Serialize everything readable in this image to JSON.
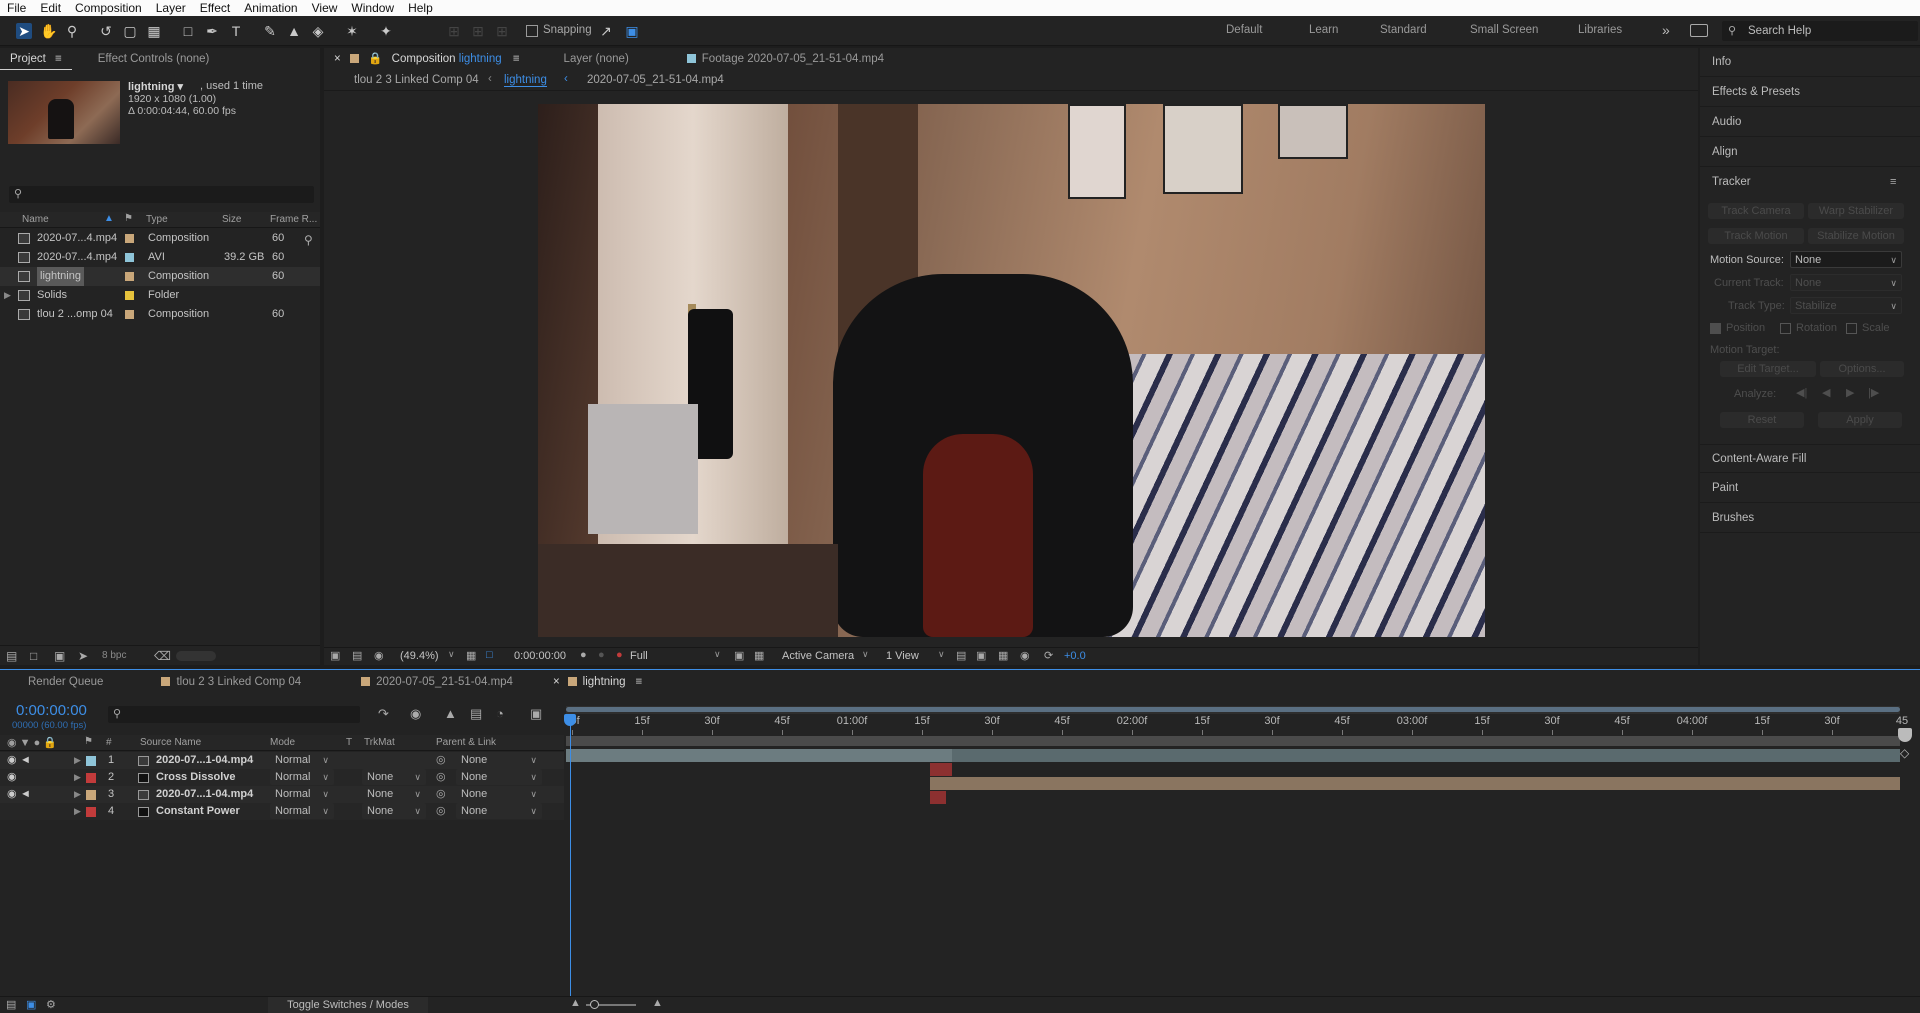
{
  "menu": [
    "File",
    "Edit",
    "Composition",
    "Layer",
    "Effect",
    "Animation",
    "View",
    "Window",
    "Help"
  ],
  "toolbar": {
    "snapping": "Snapping",
    "workspaces": [
      "Default",
      "Learn",
      "Standard",
      "Small Screen",
      "Libraries"
    ],
    "search_placeholder": "Search Help"
  },
  "project": {
    "tabs": [
      "Project",
      "Effect Controls (none)"
    ],
    "preview": {
      "name": "lightning ▾",
      "used": ", used 1 time",
      "dims": "1920 x 1080 (1.00)",
      "duration": "Δ 0:00:04:44, 60.00 fps"
    },
    "columns": [
      "Name",
      "Type",
      "Size",
      "Frame R..."
    ],
    "items": [
      {
        "name": "2020-07...4.mp4",
        "type": "Composition",
        "size": "",
        "fps": "60",
        "color": "#c9a77a",
        "icon": "comp-icon"
      },
      {
        "name": "2020-07...4.mp4",
        "type": "AVI",
        "size": "39.2 GB",
        "fps": "60",
        "color": "#8ec4d8",
        "icon": "file-icon"
      },
      {
        "name": "lightning",
        "type": "Composition",
        "size": "",
        "fps": "60",
        "color": "#c9a77a",
        "icon": "comp-icon"
      },
      {
        "name": "Solids",
        "type": "Folder",
        "size": "",
        "fps": "",
        "color": "#e6c23c",
        "icon": "folder-icon"
      },
      {
        "name": "tlou 2 ...omp 04",
        "type": "Composition",
        "size": "",
        "fps": "60",
        "color": "#c9a77a",
        "icon": "comp-icon"
      }
    ],
    "bpc": "8 bpc"
  },
  "comp": {
    "tabs": [
      {
        "prefix": "Composition",
        "name": "lightning"
      },
      {
        "prefix": "Layer",
        "name": "(none)"
      },
      {
        "prefix": "Footage",
        "name": "2020-07-05_21-51-04.mp4"
      }
    ],
    "breadcrumbs": [
      "tlou 2 3 Linked Comp 04",
      "lightning",
      "2020-07-05_21-51-04.mp4"
    ],
    "footer": {
      "zoom": "(49.4%)",
      "time": "0:00:00:00",
      "resolution": "Full",
      "camera": "Active Camera",
      "view": "1 View",
      "exposure": "+0.0"
    }
  },
  "right": {
    "sections_top": [
      "Info",
      "Effects & Presets",
      "Audio",
      "Align"
    ],
    "tracker": {
      "title": "Tracker",
      "buttons": [
        "Track Camera",
        "Warp Stabilizer",
        "Track Motion",
        "Stabilize Motion"
      ],
      "motion_source_label": "Motion Source:",
      "motion_source": "None",
      "current_track_label": "Current Track:",
      "current_track": "None",
      "track_type_label": "Track Type:",
      "track_type": "Stabilize",
      "checks": [
        "Position",
        "Rotation",
        "Scale"
      ],
      "motion_target": "Motion Target:",
      "edit_target": "Edit Target...",
      "options": "Options...",
      "analyze": "Analyze:",
      "reset": "Reset",
      "apply": "Apply"
    },
    "sections_bottom": [
      "Content-Aware Fill",
      "Paint",
      "Brushes"
    ]
  },
  "timeline": {
    "tabs": [
      "Render Queue",
      "tlou 2 3 Linked Comp 04",
      "2020-07-05_21-51-04.mp4",
      "lightning"
    ],
    "timecode": "0:00:00:00",
    "frames": "00000 (60.00 fps)",
    "columns": [
      "#",
      "Source Name",
      "Mode",
      "T",
      "TrkMat",
      "Parent & Link"
    ],
    "layers": [
      {
        "num": "1",
        "name": "2020-07...1-04.mp4",
        "mode": "Normal",
        "trkmat": "",
        "parent": "None",
        "color": "#8ec4d8",
        "icon": "file-icon",
        "eye": true,
        "audio": true
      },
      {
        "num": "2",
        "name": "Cross Dissolve",
        "mode": "Normal",
        "trkmat": "None",
        "parent": "None",
        "color": "#c23b3b",
        "icon": "solid-icon",
        "eye": true,
        "audio": false
      },
      {
        "num": "3",
        "name": "2020-07...1-04.mp4",
        "mode": "Normal",
        "trkmat": "None",
        "parent": "None",
        "color": "#c9a77a",
        "icon": "comp-icon",
        "eye": true,
        "audio": true
      },
      {
        "num": "4",
        "name": "Constant Power",
        "mode": "Normal",
        "trkmat": "None",
        "parent": "None",
        "color": "#c23b3b",
        "icon": "solid-icon",
        "eye": false,
        "audio": false
      }
    ],
    "ruler": [
      "00f",
      "15f",
      "30f",
      "45f",
      "01:00f",
      "15f",
      "30f",
      "45f",
      "02:00f",
      "15f",
      "30f",
      "45f",
      "03:00f",
      "15f",
      "30f",
      "45f",
      "04:00f",
      "15f",
      "30f",
      "45"
    ],
    "toggle": "Toggle Switches / Modes"
  }
}
